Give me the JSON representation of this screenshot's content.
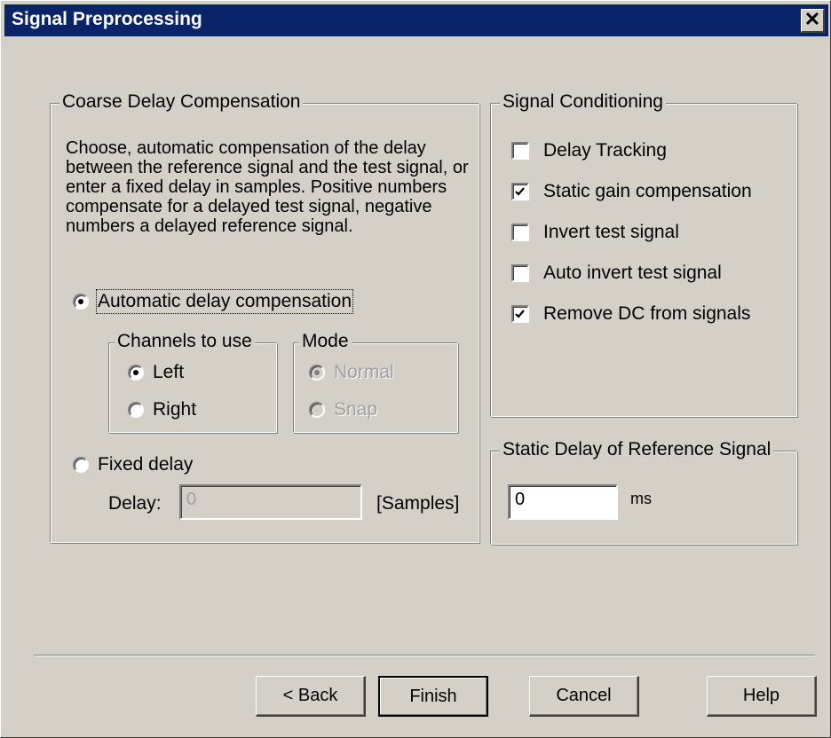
{
  "window": {
    "title": "Signal Preprocessing",
    "close_glyph": "✕"
  },
  "coarse": {
    "legend": "Coarse Delay Compensation",
    "description": "Choose, automatic compensation of the delay between the reference signal and the test signal, or enter a fixed delay in samples. Positive numbers compensate for a delayed test signal, negative numbers a delayed reference signal.",
    "auto_label": "Automatic delay compensation",
    "auto_selected": true,
    "channels": {
      "legend": "Channels to use",
      "left_label": "Left",
      "right_label": "Right",
      "selected": "Left"
    },
    "mode": {
      "legend": "Mode",
      "normal_label": "Normal",
      "snap_label": "Snap",
      "selected": "Normal",
      "enabled": false
    },
    "fixed_label": "Fixed delay",
    "delay_label": "Delay:",
    "delay_value": "0",
    "delay_unit": "[Samples]"
  },
  "conditioning": {
    "legend": "Signal Conditioning",
    "items": [
      {
        "label": "Delay Tracking",
        "checked": false
      },
      {
        "label": "Static gain compensation",
        "checked": true
      },
      {
        "label": "Invert test signal",
        "checked": false
      },
      {
        "label": "Auto invert test signal",
        "checked": false
      },
      {
        "label": "Remove DC from signals",
        "checked": true
      }
    ]
  },
  "static_delay": {
    "legend": "Static Delay of Reference Signal",
    "value": "0",
    "unit": "ms"
  },
  "buttons": {
    "back": "< Back",
    "finish": "Finish",
    "cancel": "Cancel",
    "help": "Help"
  }
}
